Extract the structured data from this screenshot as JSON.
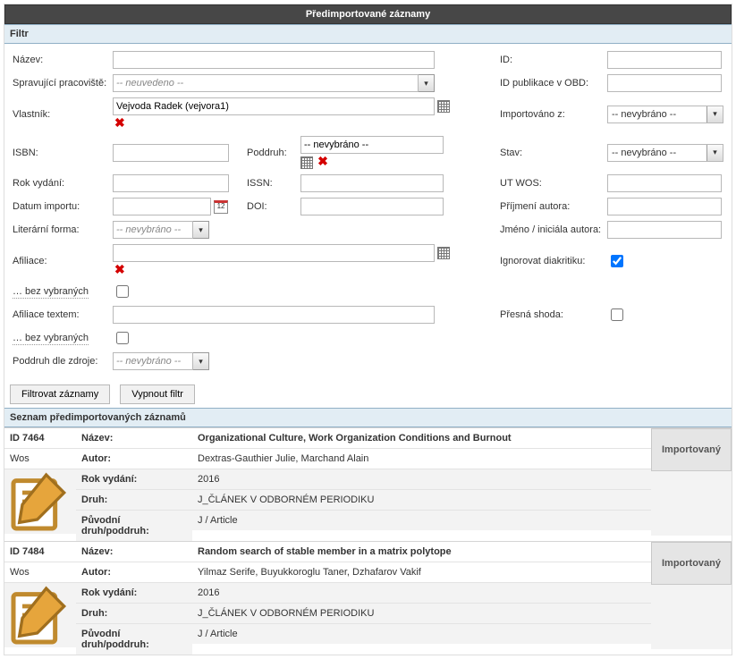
{
  "title": "Předimportované záznamy",
  "filter": {
    "heading": "Filtr",
    "labels": {
      "nazev": "Název:",
      "pracoviste": "Spravující pracoviště:",
      "vlastnik": "Vlastník:",
      "isbn": "ISBN:",
      "poddruh": "Poddruh:",
      "rok": "Rok vydání:",
      "issn": "ISSN:",
      "datum": "Datum importu:",
      "doi": "DOI:",
      "litforma": "Literární forma:",
      "afiliace": "Afiliace:",
      "bezvyb": "… bez vybraných",
      "afiltext": "Afiliace textem:",
      "poddruhzdr": "Poddruh dle zdroje:",
      "id": "ID:",
      "idobd": "ID publikace v OBD:",
      "importz": "Importováno z:",
      "stav": "Stav:",
      "utwos": "UT WOS:",
      "prijmeni": "Příjmení autora:",
      "jmeno": "Jméno / iniciála autora:",
      "ignore": "Ignorovat diakritiku:",
      "presna": "Přesná shoda:"
    },
    "values": {
      "pracoviste": "-- neuvedeno --",
      "vlastnik": "Vejvoda Radek (vejvora1)",
      "poddruh": "-- nevybráno --",
      "litforma": "-- nevybráno --",
      "poddruhzdr": "-- nevybráno --",
      "importz": "-- nevybráno --",
      "stav": "-- nevybráno --"
    },
    "buttons": {
      "filter": "Filtrovat záznamy",
      "off": "Vypnout filtr"
    }
  },
  "list": {
    "heading": "Seznam předimportovaných záznamů",
    "labels": {
      "nazev": "Název:",
      "autor": "Autor:",
      "rok": "Rok vydání:",
      "druh": "Druh:",
      "puvodni": "Původní druh/poddruh:"
    },
    "status": "Importovaný",
    "records": [
      {
        "id": "ID 7464",
        "src": "Wos",
        "nazev": "Organizational Culture, Work Organization Conditions and Burnout",
        "autor": "Dextras-Gauthier Julie, Marchand Alain",
        "rok": "2016",
        "druh": "J_ČLÁNEK V ODBORNÉM PERIODIKU",
        "puvodni": "J / Article"
      },
      {
        "id": "ID 7484",
        "src": "Wos",
        "nazev": "Random search of stable member in a matrix polytope",
        "autor": "Yilmaz Serife, Buyukkoroglu Taner, Dzhafarov Vakif",
        "rok": "2016",
        "druh": "J_ČLÁNEK V ODBORNÉM PERIODIKU",
        "puvodni": "J / Article"
      }
    ]
  }
}
